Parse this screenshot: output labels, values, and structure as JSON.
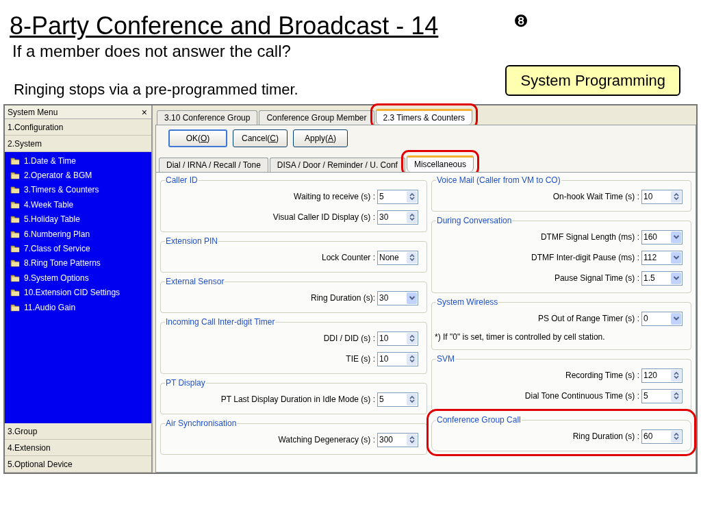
{
  "slide": {
    "title": "8-Party Conference and Broadcast - 14",
    "page_mark": "❽",
    "subtitle": "If a member does not answer the call?",
    "caption": "Ringing stops via a pre-programmed timer.",
    "badge": "System Programming"
  },
  "sidebar": {
    "title": "System Menu",
    "close": "×",
    "categories": [
      {
        "label": "1.Configuration"
      },
      {
        "label": "2.System",
        "children": [
          "1.Date & Time",
          "2.Operator & BGM",
          "3.Timers & Counters",
          "4.Week Table",
          "5.Holiday Table",
          "6.Numbering Plan",
          "7.Class of Service",
          "8.Ring Tone Patterns",
          "9.System Options",
          "10.Extension CID Settings",
          "11.Audio Gain"
        ]
      },
      {
        "label": "3.Group"
      },
      {
        "label": "4.Extension"
      },
      {
        "label": "5.Optional Device"
      }
    ]
  },
  "tabs": [
    {
      "label": "3.10 Conference Group",
      "selected": false,
      "highlighted": false
    },
    {
      "label": "Conference Group Member",
      "selected": false,
      "highlighted": false
    },
    {
      "label": "2.3 Timers & Counters",
      "selected": true,
      "highlighted": true
    }
  ],
  "buttons": [
    {
      "label": "OK(",
      "key": "O",
      "label_end": ")",
      "default": true
    },
    {
      "label": "Cancel(",
      "key": "C",
      "label_end": ")",
      "default": false
    },
    {
      "label": "Apply(",
      "key": "A",
      "label_end": ")",
      "default": false
    }
  ],
  "subtabs": [
    {
      "label": "Dial / IRNA / Recall / Tone",
      "selected": false,
      "highlighted": false
    },
    {
      "label": "DISA / Door / Reminder / U. Conf",
      "selected": false,
      "highlighted": false
    },
    {
      "label": "Miscellaneous",
      "selected": true,
      "highlighted": true
    }
  ],
  "columns": [
    [
      {
        "title": "Caller ID",
        "highlighted": false,
        "fields": [
          {
            "label": "Waiting to receive (s) :",
            "value": "5",
            "kind": "spin"
          },
          {
            "label": "Visual Caller ID Display (s) :",
            "value": "30",
            "kind": "spin"
          }
        ]
      },
      {
        "title": "Extension PIN",
        "highlighted": false,
        "fields": [
          {
            "label": "Lock Counter :",
            "value": "None",
            "kind": "spin"
          }
        ]
      },
      {
        "title": "External Sensor",
        "highlighted": false,
        "fields": [
          {
            "label": "Ring Duration (s):",
            "value": "30",
            "kind": "dropdown"
          }
        ]
      },
      {
        "title": "Incoming Call Inter-digit Timer",
        "highlighted": false,
        "fields": [
          {
            "label": "DDI / DID (s) :",
            "value": "10",
            "kind": "spin"
          },
          {
            "label": "TIE (s) :",
            "value": "10",
            "kind": "spin"
          }
        ]
      },
      {
        "title": "PT Display",
        "highlighted": false,
        "fields": [
          {
            "label": "PT Last Display Duration in Idle Mode (s) :",
            "value": "5",
            "kind": "spin"
          }
        ]
      },
      {
        "title": "Air Synchronisation",
        "highlighted": false,
        "fields": [
          {
            "label": "Watching Degeneracy (s) :",
            "value": "300",
            "kind": "spin"
          }
        ]
      }
    ],
    [
      {
        "title": "Voice Mail (Caller from VM to CO)",
        "highlighted": false,
        "fields": [
          {
            "label": "On-hook Wait Time (s) :",
            "value": "10",
            "kind": "spin"
          }
        ]
      },
      {
        "title": "During Conversation",
        "highlighted": false,
        "fields": [
          {
            "label": "DTMF Signal Length (ms) :",
            "value": "160",
            "kind": "dropdown"
          },
          {
            "label": "DTMF Inter-digit Pause (ms) :",
            "value": "112",
            "kind": "dropdown"
          },
          {
            "label": "Pause Signal Time (s) :",
            "value": "1.5",
            "kind": "dropdown"
          }
        ]
      },
      {
        "title": "System Wireless",
        "highlighted": false,
        "fields": [
          {
            "label": "PS Out of Range Timer (s) :",
            "value": "0",
            "kind": "dropdown"
          }
        ],
        "note": "*) If \"0\" is set, timer is controlled by cell station."
      },
      {
        "title": "SVM",
        "highlighted": false,
        "fields": [
          {
            "label": "Recording Time (s) :",
            "value": "120",
            "kind": "spin"
          },
          {
            "label": "Dial Tone Continuous Time (s) :",
            "value": "5",
            "kind": "spin"
          }
        ]
      },
      {
        "title": "Conference Group Call",
        "highlighted": true,
        "fields": [
          {
            "label": "Ring Duration (s) :",
            "value": "60",
            "kind": "spin"
          }
        ]
      }
    ]
  ]
}
